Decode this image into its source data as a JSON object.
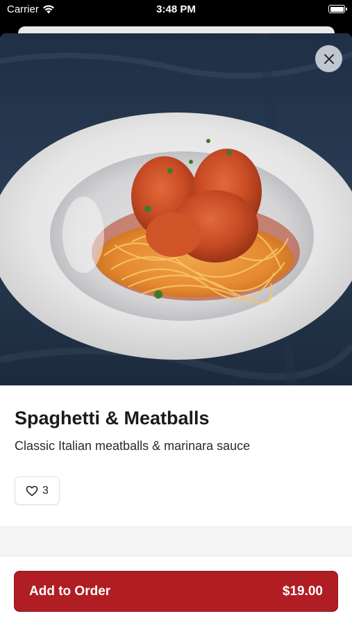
{
  "status_bar": {
    "carrier": "Carrier",
    "time": "3:48 PM"
  },
  "item": {
    "title": "Spaghetti & Meatballs",
    "description": "Classic Italian meatballs & marinara sauce",
    "image_icon": "spaghetti-meatballs-photo"
  },
  "likes": {
    "icon": "heart-icon",
    "count": "3"
  },
  "close": {
    "icon": "close-icon"
  },
  "order_button": {
    "label": "Add to Order",
    "price": "$19.00"
  },
  "colors": {
    "accent": "#b01e24",
    "background": "#ffffff",
    "status_bar": "#000000"
  }
}
